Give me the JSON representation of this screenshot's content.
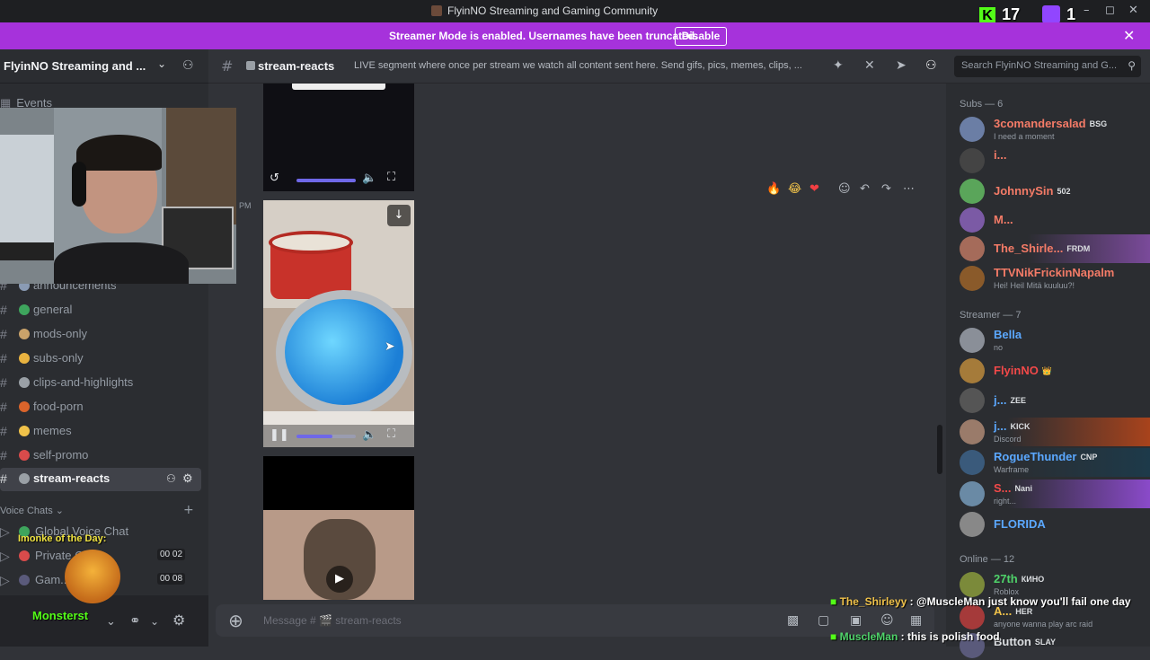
{
  "window": {
    "title": "FlyinNO Streaming and Gaming Community"
  },
  "stream_overlay": {
    "kick_count": "17",
    "twitch_count": "1",
    "monke_label": "Imonke of the Day:",
    "monke_name": "Monsterst"
  },
  "streamer_mode": {
    "message": "Streamer Mode is enabled. Usernames have been truncated.",
    "disable_label": "Disable"
  },
  "server": {
    "name": "FlyinNO Streaming and ..."
  },
  "sidebar": {
    "events_label": "Events",
    "channels": [
      {
        "label": "announcements",
        "emoji_color": "#8a9bb4"
      },
      {
        "label": "general",
        "emoji_color": "#3ea55d"
      },
      {
        "label": "mods-only",
        "emoji_color": "#c9a26a"
      },
      {
        "label": "subs-only",
        "emoji_color": "#e9b340"
      },
      {
        "label": "clips-and-highlights",
        "emoji_color": "#9aa0a6"
      },
      {
        "label": "food-porn",
        "emoji_color": "#d9642b"
      },
      {
        "label": "memes",
        "emoji_color": "#f0c24a"
      },
      {
        "label": "self-promo",
        "emoji_color": "#d84b4b"
      },
      {
        "label": "stream-reacts",
        "emoji_color": "#9aa0a6"
      }
    ],
    "voice_category": "Voice Chats",
    "voice_channels": [
      {
        "label": "Global Voice Chat",
        "count_a": "",
        "count_b": ""
      },
      {
        "label": "Private Chat",
        "count_a": "00",
        "count_b": "02"
      },
      {
        "label": "Gam...",
        "count_a": "00",
        "count_b": "08"
      }
    ]
  },
  "channel_header": {
    "name": "stream-reacts",
    "topic": "LIVE segment where once per stream we watch all content sent here. Send gifs, pics, memes, clips, ...",
    "search_placeholder": "Search FlyinNO Streaming and G..."
  },
  "messages": {
    "timestamp_suffix": "PM",
    "reactions": [
      "🔥",
      "😂",
      "❤"
    ]
  },
  "composer": {
    "placeholder": "Message # 🎬 stream-reacts"
  },
  "members": {
    "groups": [
      {
        "title": "Subs — 6",
        "items": [
          {
            "name": "3comandersalad",
            "tag": "BSG",
            "status": "I need a moment",
            "color": "#f47b67",
            "avatar": "#6b7ea5"
          },
          {
            "name": "i...",
            "tag": "",
            "status": "",
            "color": "#f47b67",
            "avatar": "#444"
          },
          {
            "name": "JohnnySin",
            "tag": "502",
            "status": "",
            "color": "#f47b67",
            "avatar": "#5aa55a"
          },
          {
            "name": "M...",
            "tag": "",
            "status": "",
            "color": "#f47b67",
            "avatar": "#7b5aa5"
          },
          {
            "name": "The_Shirle...",
            "tag": "FRDM",
            "status": "",
            "color": "#f47b67",
            "avatar": "#a56b5a"
          },
          {
            "name": "TTVNikFrickinNapalm",
            "tag": "",
            "status": "Hei! Heil Mitä kuuluu?!",
            "color": "#f47b67",
            "avatar": "#8a5a2a"
          }
        ]
      },
      {
        "title": "Streamer — 7",
        "items": [
          {
            "name": "Bella",
            "tag": "",
            "status": "no",
            "color": "#5ba8ff",
            "avatar": "#8a8f98"
          },
          {
            "name": "FlyinNO",
            "tag": "👑",
            "status": "",
            "color": "#f24949",
            "avatar": "#a57b3a"
          },
          {
            "name": "j...",
            "tag": "ZEE",
            "status": "",
            "color": "#5ba8ff",
            "avatar": "#555"
          },
          {
            "name": "j...",
            "tag": "KICK",
            "status": "Discord",
            "color": "#5ba8ff",
            "avatar": "#9a7b6a"
          },
          {
            "name": "RogueThunder",
            "tag": "CNP",
            "status": "Warframe",
            "color": "#5ba8ff",
            "avatar": "#3a5a7b"
          },
          {
            "name": "S...",
            "tag": "Nani",
            "status": "right...",
            "color": "#f24949",
            "avatar": "#6a8aa5"
          },
          {
            "name": "FLORIDA",
            "tag": "",
            "status": "",
            "color": "#5ba8ff",
            "avatar": "#888"
          }
        ]
      },
      {
        "title": "Online — 12",
        "items": [
          {
            "name": "27th",
            "tag": "КИНО",
            "status": "Roblox",
            "color": "#4fd36a",
            "avatar": "#7b8a3a"
          },
          {
            "name": "A...",
            "tag": "HER",
            "status": "anyone wanna play arc raid",
            "color": "#f0c24a",
            "avatar": "#a53a3a"
          },
          {
            "name": "Button",
            "tag": "SLAY",
            "status": "",
            "color": "#dbdee1",
            "avatar": "#5a5a7b"
          }
        ]
      }
    ]
  },
  "chat_overlay": [
    {
      "user": "The_Shirleyy",
      "text": " @MuscleMan just know you'll fail one day",
      "color": "#f0c24a"
    },
    {
      "user": "MuscleMan",
      "text": " this is polish food",
      "color": "#4fd36a"
    }
  ]
}
